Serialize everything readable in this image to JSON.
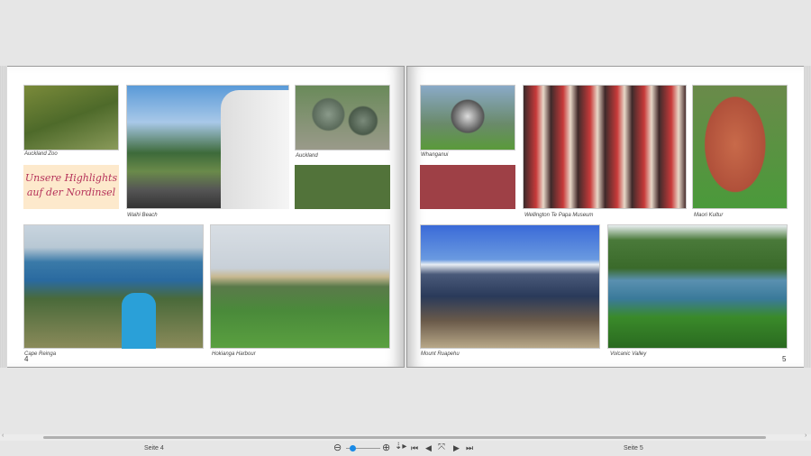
{
  "left_page": {
    "number": "4",
    "title_box": {
      "line1": "Unsere Highlights",
      "line2": "auf der Nordinsel",
      "bg": "#fde9cc",
      "color": "#b5325a"
    },
    "captions": {
      "zoo": "Auckland Zoo",
      "waihi": "Waihi Beach",
      "auckland": "Auckland",
      "cape": "Cape Reinga",
      "hokianga": "Hokianga Harbour"
    },
    "green_box": "#52733a"
  },
  "right_page": {
    "number": "5",
    "captions": {
      "whanganui": "Whanganui",
      "wellington": "Wellington Te Papa Museum",
      "maori": "Maori Kultur",
      "ruapehu": "Mount Ruapehu",
      "volcanic": "Volcanic Valley"
    },
    "red_box": "#9e4046"
  },
  "footer": {
    "left_label": "Seite 4",
    "right_label": "Seite 5",
    "zoom_level": 0.15
  }
}
